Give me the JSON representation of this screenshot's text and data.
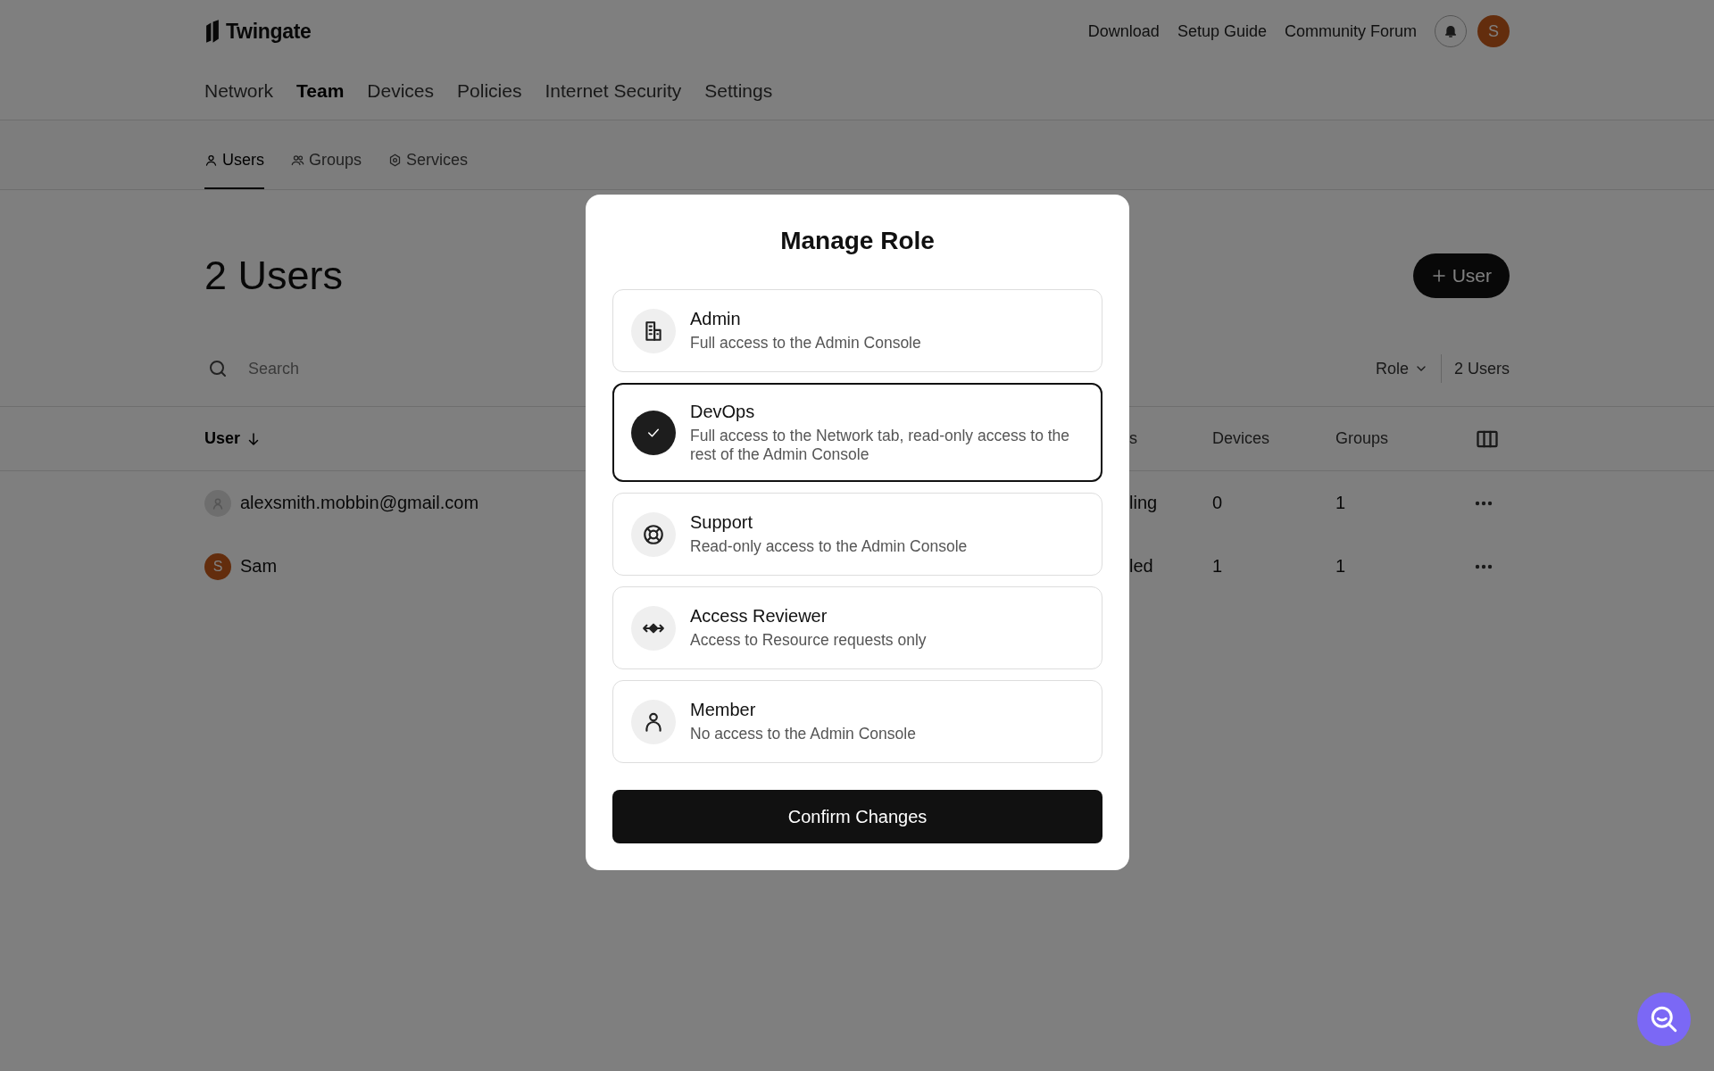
{
  "brand": {
    "name": "Twingate"
  },
  "top_links": [
    "Download",
    "Setup Guide",
    "Community Forum"
  ],
  "account": {
    "initial": "S"
  },
  "main_tabs": [
    {
      "label": "Network",
      "selected": false
    },
    {
      "label": "Team",
      "selected": true
    },
    {
      "label": "Devices",
      "selected": false
    },
    {
      "label": "Policies",
      "selected": false
    },
    {
      "label": "Internet Security",
      "selected": false
    },
    {
      "label": "Settings",
      "selected": false
    }
  ],
  "sub_tabs": [
    {
      "label": "Users",
      "selected": true
    },
    {
      "label": "Groups",
      "selected": false
    },
    {
      "label": "Services",
      "selected": false
    }
  ],
  "page_title": "2 Users",
  "add_button": "User",
  "search": {
    "placeholder": "Search"
  },
  "filter": "Role",
  "count": "2 Users",
  "table": {
    "columns": [
      {
        "label": "User",
        "sorted": true
      },
      {
        "label": "s",
        "sorted": false
      },
      {
        "label": "Devices",
        "sorted": false
      },
      {
        "label": "Groups",
        "sorted": false
      }
    ],
    "rows": [
      {
        "avatar": {
          "kind": "generic"
        },
        "cells": [
          "alexsmith.mobbin@gmail.com",
          "ling",
          "0",
          "1"
        ]
      },
      {
        "avatar": {
          "kind": "initial",
          "letter": "S"
        },
        "cells": [
          "Sam",
          "led",
          "1",
          "1"
        ]
      }
    ]
  },
  "modal": {
    "title": "Manage Role",
    "roles": [
      {
        "name": "Admin",
        "description": "Full access to the Admin Console",
        "selected": false
      },
      {
        "name": "DevOps",
        "description": "Full access to the Network tab, read-only access to the rest of the Admin Console",
        "selected": true
      },
      {
        "name": "Support",
        "description": "Read-only access to the Admin Console",
        "selected": false
      },
      {
        "name": "Access Reviewer",
        "description": "Access to Resource requests only",
        "selected": false
      },
      {
        "name": "Member",
        "description": "No access to the Admin Console",
        "selected": false
      }
    ],
    "confirm": "Confirm Changes"
  }
}
